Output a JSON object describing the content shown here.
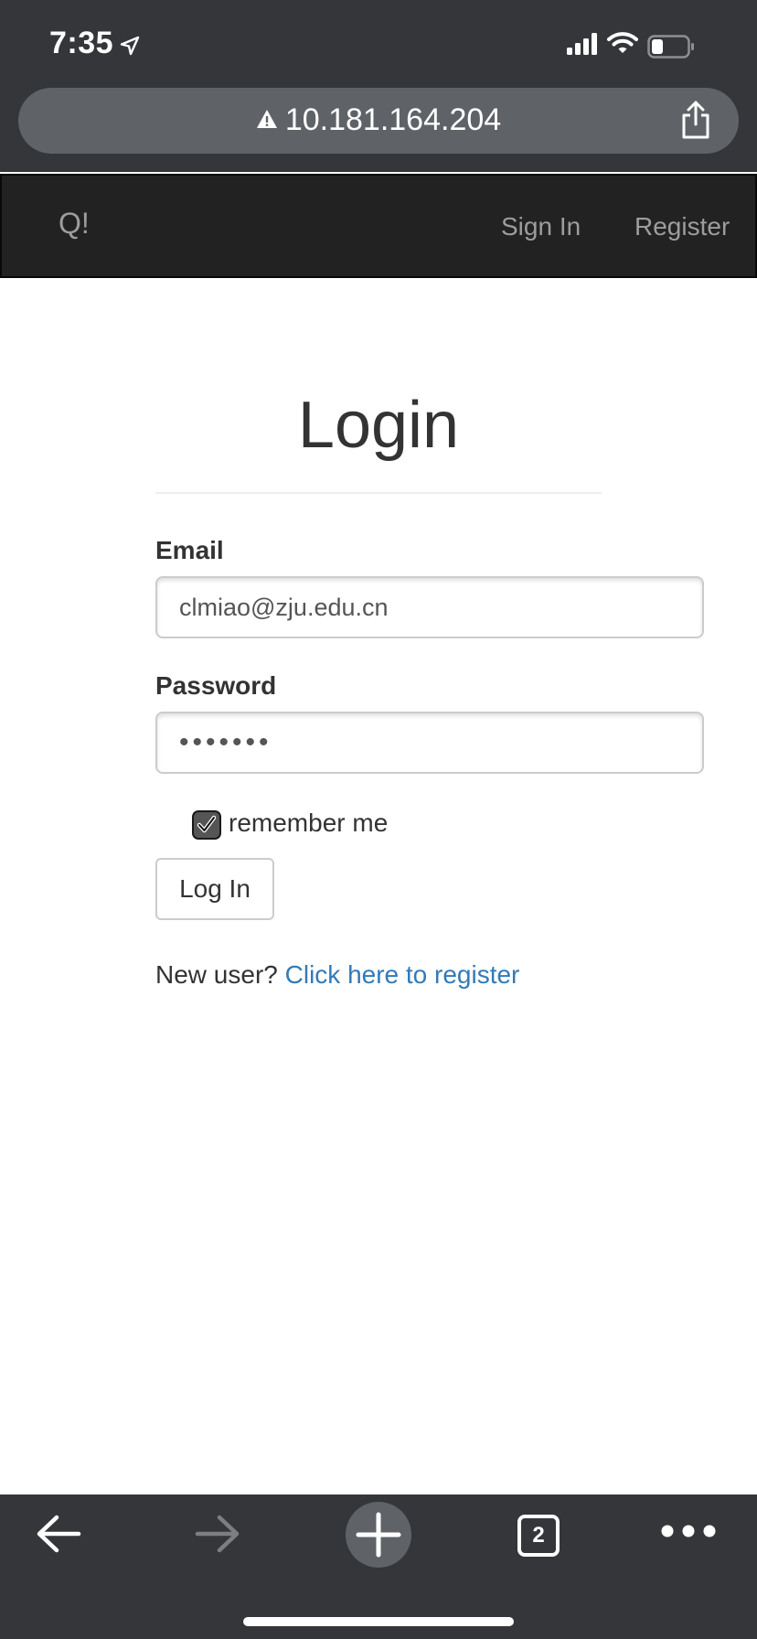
{
  "status_bar": {
    "time": "7:35"
  },
  "browser": {
    "url": "10.181.164.204",
    "open_tabs": "2"
  },
  "navbar": {
    "brand": "Q!",
    "sign_in": "Sign In",
    "register": "Register"
  },
  "login": {
    "title": "Login",
    "email_label": "Email",
    "email_value": "clmiao@zju.edu.cn",
    "password_label": "Password",
    "password_value": "•••••••",
    "remember_label": "remember me",
    "remember_checked": true,
    "submit_label": "Log In",
    "new_user_text": "New user?",
    "register_link": "Click here to register"
  },
  "colors": {
    "chrome_bg": "#35363a",
    "navbar_bg": "#222222",
    "link": "#337ab7"
  }
}
